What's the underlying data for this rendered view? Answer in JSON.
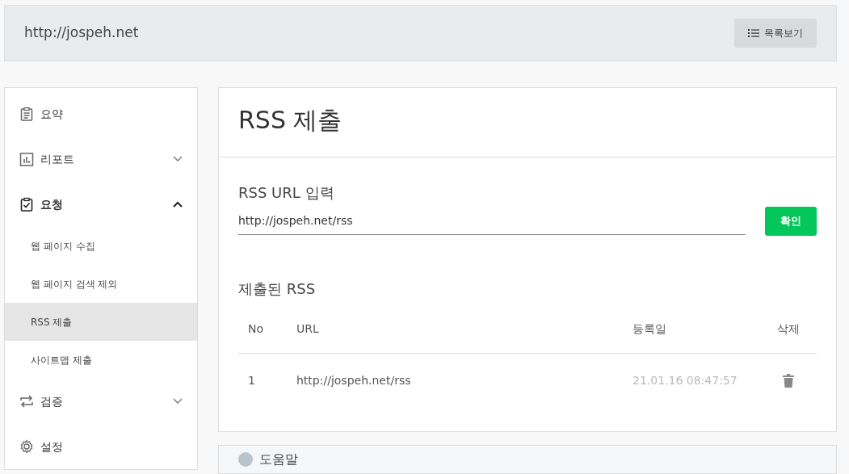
{
  "header": {
    "site": "http://jospeh.net",
    "list_button": "목록보기"
  },
  "sidebar": {
    "items": [
      {
        "label": "요약",
        "kind": "summary"
      },
      {
        "label": "리포트",
        "kind": "report",
        "expanded": false
      },
      {
        "label": "요청",
        "kind": "request",
        "expanded": true,
        "children": [
          {
            "label": "웹 페이지 수집",
            "selected": false
          },
          {
            "label": "웹 페이지 검색 제외",
            "selected": false
          },
          {
            "label": "RSS 제출",
            "selected": true
          },
          {
            "label": "사이트맵 제출",
            "selected": false
          }
        ]
      },
      {
        "label": "검증",
        "kind": "verify",
        "expanded": false
      },
      {
        "label": "설정",
        "kind": "settings"
      }
    ]
  },
  "page_title": "RSS 제출",
  "rss_input": {
    "label": "RSS URL 입력",
    "value": "http://jospeh.net/rss",
    "button": "확인"
  },
  "submitted": {
    "title": "제출된 RSS",
    "columns": [
      "No",
      "URL",
      "등록일",
      "삭제"
    ],
    "rows": [
      {
        "no": "1",
        "url": "http://jospeh.net/rss",
        "date": "21.01.16 08:47:57"
      }
    ]
  },
  "help": {
    "title": "도움말"
  }
}
